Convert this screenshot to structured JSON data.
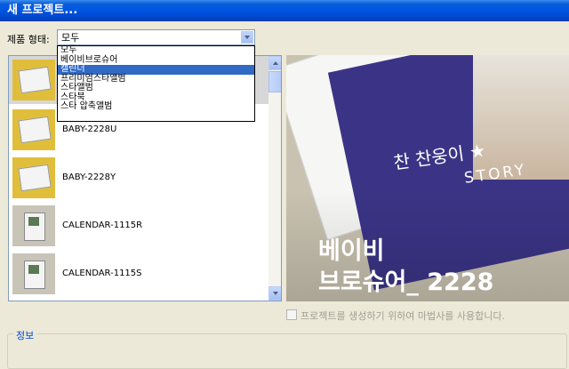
{
  "window": {
    "title": "새 프로젝트..."
  },
  "filter": {
    "label": "제품 형태:",
    "selected": "모두",
    "options": [
      "모두",
      "베이비브로슈어",
      "캘린더",
      "프리미엄스타앨범",
      "스타앨범",
      "스타북",
      "스타 압축앨범"
    ],
    "highlighted_index": 2
  },
  "products": [
    {
      "name": "",
      "thumb": "baby-brochure-thumbnail"
    },
    {
      "name": "BABY-2228U",
      "thumb": "baby-brochure-thumbnail"
    },
    {
      "name": "BABY-2228Y",
      "thumb": "baby-brochure-thumbnail"
    },
    {
      "name": "CALENDAR-1115R",
      "thumb": "calendar-thumbnail"
    },
    {
      "name": "CALENDAR-1115S",
      "thumb": "calendar-thumbnail"
    }
  ],
  "preview": {
    "story_korean": "찬 찬웅이 ★",
    "story_english": "STORY",
    "caption_line1": "베이비",
    "caption_line2": "브로슈어_ 2228"
  },
  "wizard_checkbox": {
    "label": "프로젝트를 생성하기 위하여 마법사를 사용합니다.",
    "checked": false,
    "enabled": false
  },
  "info_group": {
    "label": "정보"
  },
  "colors": {
    "titlebar": "#0054e3",
    "highlight": "#316ac5",
    "window_bg": "#ece9d8",
    "group_label": "#0046d5"
  }
}
